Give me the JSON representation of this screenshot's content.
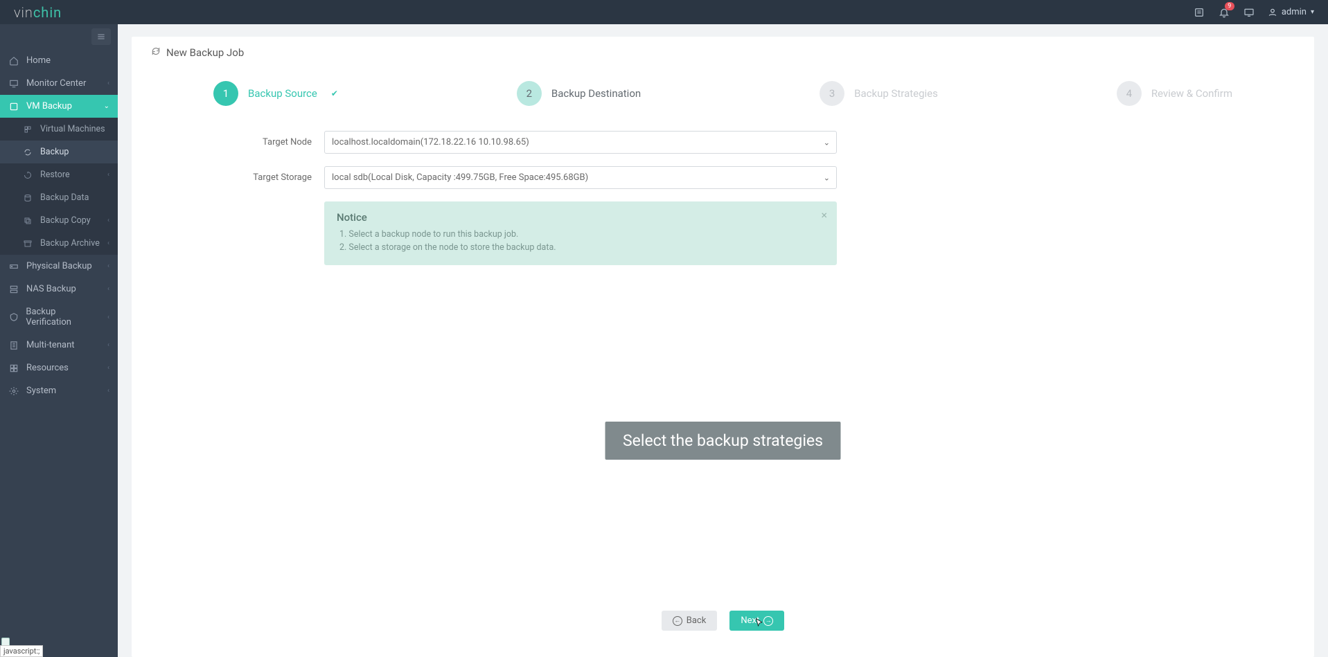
{
  "brand": {
    "part1": "vin",
    "part2": "chin"
  },
  "topbar": {
    "badge": "9",
    "user": "admin"
  },
  "sidebar": {
    "home": "Home",
    "monitor": "Monitor Center",
    "vmbackup": "VM Backup",
    "sub": {
      "vms": "Virtual Machines",
      "backup": "Backup",
      "restore": "Restore",
      "backupdata": "Backup Data",
      "backupcopy": "Backup Copy",
      "backuparchive": "Backup Archive"
    },
    "physical": "Physical Backup",
    "nas": "NAS Backup",
    "verification": "Backup Verification",
    "multitenant": "Multi-tenant",
    "resources": "Resources",
    "system": "System"
  },
  "panel": {
    "title": "New Backup Job"
  },
  "steps": {
    "s1": "Backup Source",
    "s2": "Backup Destination",
    "s3": "Backup Strategies",
    "s4": "Review & Confirm",
    "n1": "1",
    "n2": "2",
    "n3": "3",
    "n4": "4"
  },
  "form": {
    "target_node_label": "Target Node",
    "target_node_value": "localhost.localdomain(172.18.22.16 10.10.98.65)",
    "target_storage_label": "Target Storage",
    "target_storage_value": "local sdb(Local Disk, Capacity :499.75GB, Free Space:495.68GB)"
  },
  "notice": {
    "title": "Notice",
    "line1": "1. Select a backup node to run this backup job.",
    "line2": "2. Select a storage on the node to store the backup data."
  },
  "overlay": "Select the backup strategies",
  "buttons": {
    "back": "Back",
    "next": "Next"
  },
  "status_hint": "javascript:;"
}
